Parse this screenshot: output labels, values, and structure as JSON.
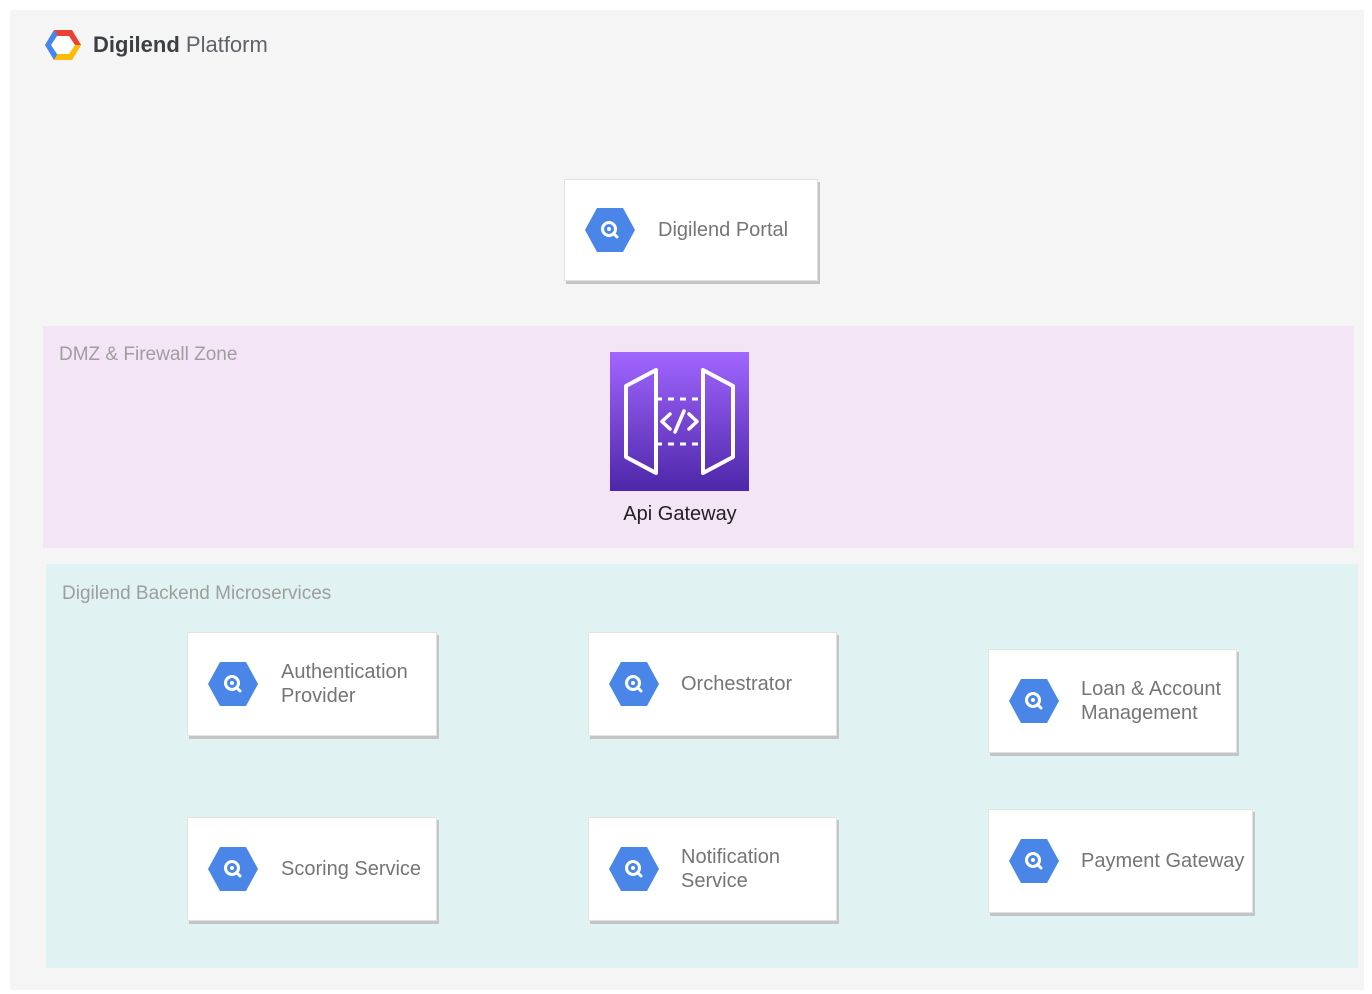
{
  "header": {
    "brand_bold": "Digilend",
    "brand_rest": "Platform",
    "logo_icon": "gcp-hexagon-logo-icon"
  },
  "portal": {
    "label": "Digilend Portal",
    "icon": "search-hexagon-icon"
  },
  "zones": {
    "dmz": {
      "label": "DMZ & Firewall Zone",
      "color": "#f3e5f5"
    },
    "backend": {
      "label": "Digilend Backend Microservices",
      "color": "#e0f2f1"
    }
  },
  "gateway": {
    "label": "Api Gateway",
    "icon": "api-gateway-icon",
    "color": "#7b3fd4"
  },
  "services": [
    {
      "line1": "Authentication",
      "line2": "Provider"
    },
    {
      "line1": "Orchestrator",
      "line2": ""
    },
    {
      "line1": "Loan & Account",
      "line2": "Management"
    },
    {
      "line1": "Scoring Service",
      "line2": ""
    },
    {
      "line1": "Notification",
      "line2": "Service"
    },
    {
      "line1": "Payment Gateway",
      "line2": ""
    }
  ],
  "colors": {
    "hex_icon": "#4a86e8",
    "canvas": "#f5f5f5"
  }
}
